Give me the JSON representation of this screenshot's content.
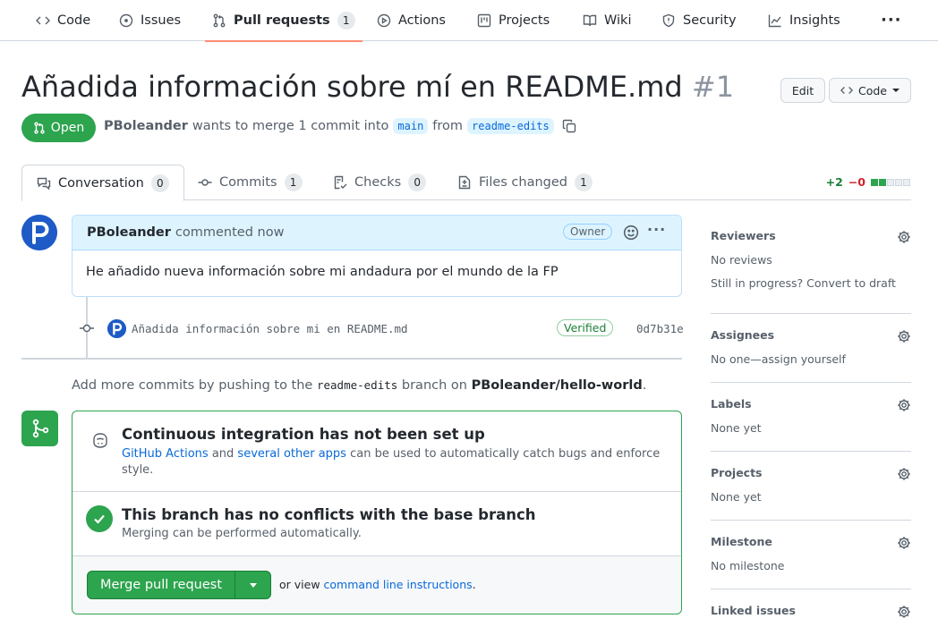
{
  "repo_nav": {
    "items": [
      {
        "label": "Code",
        "icon": "code-icon"
      },
      {
        "label": "Issues",
        "icon": "issue-icon"
      },
      {
        "label": "Pull requests",
        "icon": "pull-request-icon",
        "count": "1"
      },
      {
        "label": "Actions",
        "icon": "play-icon"
      },
      {
        "label": "Projects",
        "icon": "project-icon"
      },
      {
        "label": "Wiki",
        "icon": "book-icon"
      },
      {
        "label": "Security",
        "icon": "shield-icon"
      },
      {
        "label": "Insights",
        "icon": "graph-icon"
      }
    ],
    "more": "···"
  },
  "header": {
    "title": "Añadida información sobre mí en README.md",
    "number": "#1",
    "edit_label": "Edit",
    "code_label": "Code",
    "state_label": "Open",
    "author": "PBoleander",
    "merge_text": "wants to merge 1 commit into",
    "base_branch": "main",
    "from_text": "from",
    "head_branch": "readme-edits"
  },
  "tabs": [
    {
      "label": "Conversation",
      "count": "0",
      "icon": "comment-discussion-icon"
    },
    {
      "label": "Commits",
      "count": "1",
      "icon": "commit-icon"
    },
    {
      "label": "Checks",
      "count": "0",
      "icon": "checklist-icon"
    },
    {
      "label": "Files changed",
      "count": "1",
      "icon": "file-diff-icon"
    }
  ],
  "diffstat": {
    "additions": "+2",
    "deletions": "−0",
    "color_add": "#2da44e",
    "color_neutral": "#d0d7de"
  },
  "comment": {
    "author": "PBoleander",
    "action": "commented now",
    "badge": "Owner",
    "body": "He añadido nueva información sobre mi andadura por el mundo de la FP"
  },
  "commit": {
    "message": "Añadida información sobre mi en README.md",
    "verified": "Verified",
    "sha": "0d7b31e"
  },
  "push_info": {
    "prefix": "Add more commits by pushing to the",
    "branch": "readme-edits",
    "middle": "branch on",
    "repo": "PBoleander/hello-world",
    "suffix": "."
  },
  "merge_box": {
    "ci_title": "Continuous integration has not been set up",
    "ci_link1": "GitHub Actions",
    "ci_and": "and",
    "ci_link2": "several other apps",
    "ci_rest": "can be used to automatically catch bugs and enforce style.",
    "nc_title": "This branch has no conflicts with the base branch",
    "nc_desc": "Merging can be performed automatically.",
    "merge_label": "Merge pull request",
    "or_view": "or view",
    "cli_link": "command line instructions",
    "period": "."
  },
  "sidebar": {
    "sections": [
      {
        "title": "Reviewers",
        "values": [
          "No reviews",
          "Still in progress? Convert to draft"
        ]
      },
      {
        "title": "Assignees",
        "values": [
          "No one—assign yourself"
        ]
      },
      {
        "title": "Labels",
        "values": [
          "None yet"
        ]
      },
      {
        "title": "Projects",
        "values": [
          "None yet"
        ]
      },
      {
        "title": "Milestone",
        "values": [
          "No milestone"
        ]
      },
      {
        "title": "Linked issues",
        "values": []
      }
    ]
  },
  "colors": {
    "accent_green": "#2da44e",
    "link_blue": "#0969da",
    "nav_underline": "#fd8c73",
    "comment_header": "#ddf4ff"
  }
}
